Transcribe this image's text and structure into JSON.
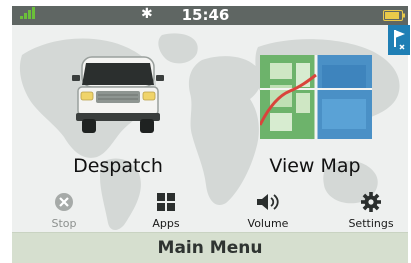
{
  "status_bar": {
    "time": "15:46",
    "bluetooth_icon": "bluetooth-icon",
    "signal_icon": "signal-icon",
    "battery_icon": "battery-icon"
  },
  "tiles": [
    {
      "label": "Despatch",
      "icon": "van-icon"
    },
    {
      "label": "View Map",
      "icon": "map-icon"
    }
  ],
  "soft_buttons": [
    {
      "label": "Stop",
      "icon": "stop-icon",
      "enabled": false
    },
    {
      "label": "Apps",
      "icon": "apps-grid-icon",
      "enabled": true
    },
    {
      "label": "Volume",
      "icon": "speaker-icon",
      "enabled": true
    },
    {
      "label": "Settings",
      "icon": "gear-icon",
      "enabled": true
    }
  ],
  "footer": {
    "title": "Main Menu"
  },
  "colors": {
    "status_bar": "#5f6663",
    "map_bg": "#eef0ef",
    "continents": "#d4d8d6",
    "footer": "#d6dfcf",
    "flag_button": "#1f7fb5"
  }
}
